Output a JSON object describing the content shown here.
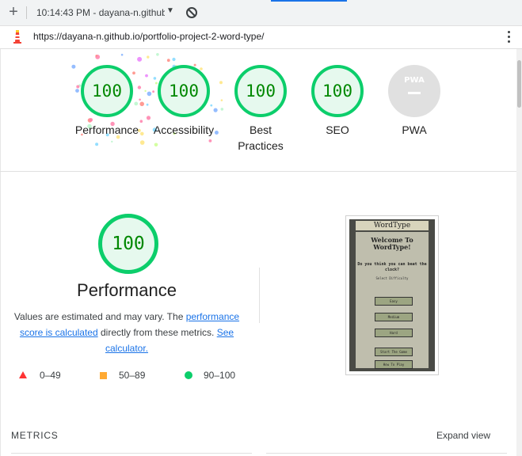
{
  "browser": {
    "new_tab": "+",
    "tab_title": "10:14:43 PM - dayana-n.github",
    "tab_dropdown": "▼",
    "url": "https://dayana-n.github.io/portfolio-project-2-word-type/"
  },
  "scores": [
    {
      "label": "Performance",
      "value": "100"
    },
    {
      "label": "Accessibility",
      "value": "100"
    },
    {
      "label": "Best Practices",
      "value": "100"
    },
    {
      "label": "SEO",
      "value": "100"
    },
    {
      "label": "PWA",
      "value": ""
    }
  ],
  "pwa_badge": "PWA",
  "performance": {
    "score": "100",
    "title": "Performance",
    "desc_text_1": "Values are estimated and may vary. The ",
    "desc_link_1": "performance score is calculated",
    "desc_text_2": " directly from these metrics. ",
    "desc_link_2": "See calculator."
  },
  "legend": {
    "poor": "0–49",
    "average": "50–89",
    "good": "90–100"
  },
  "screenshot": {
    "header": "WordType",
    "welcome": "Welcome To WordType!",
    "question": "Do you think you can beat the clock?",
    "select": "Select Difficulty",
    "buttons": [
      "Easy",
      "Medium",
      "Hard",
      "Start The Game",
      "How To Play"
    ]
  },
  "metrics": {
    "heading": "METRICS",
    "expand": "Expand view"
  },
  "colors": {
    "pass": "#0cce6b",
    "average": "#ffaa33",
    "fail": "#ff3333",
    "link": "#1a73e8"
  }
}
